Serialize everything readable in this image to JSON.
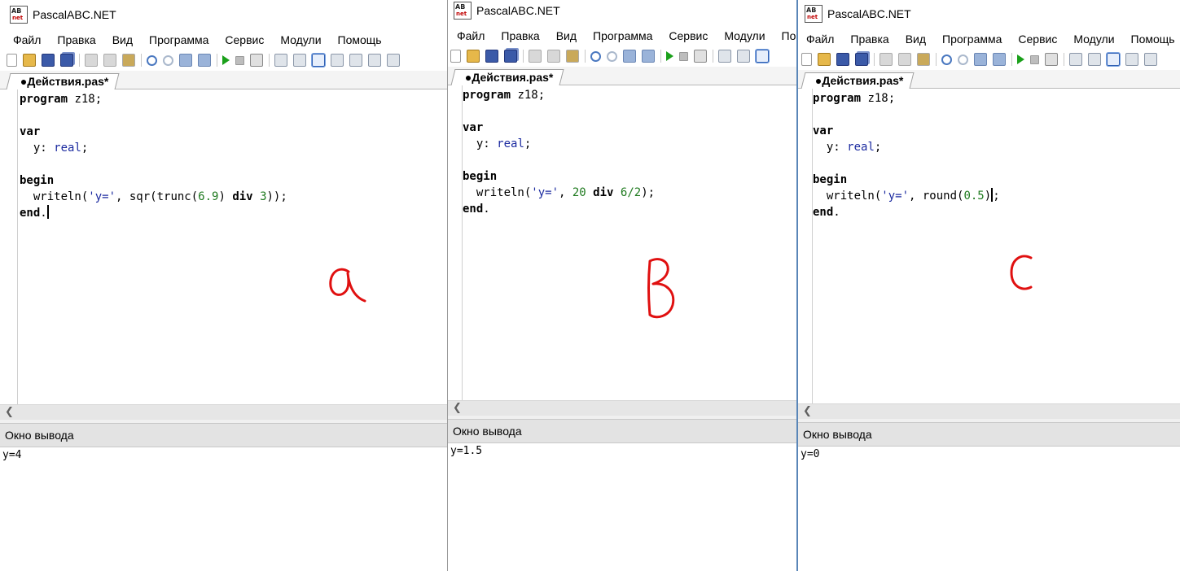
{
  "app_title": "PascalABC.NET",
  "app_icon": {
    "top": "AB",
    "bottom": "net"
  },
  "menu": [
    "Файл",
    "Правка",
    "Вид",
    "Программа",
    "Сервис",
    "Модули",
    "Помощь"
  ],
  "menu_truncated_b": "Пом",
  "tab_label": "●Действия.pas*",
  "output_title": "Окно вывода",
  "panels": {
    "a": {
      "annotation": "a",
      "output": "y=4"
    },
    "b": {
      "annotation": "B",
      "output": "y=1.5"
    },
    "c": {
      "annotation": "C",
      "output": "y=0"
    }
  },
  "code": {
    "program_kw": "program",
    "program_name": " z18;",
    "var_kw": "var",
    "decl_name": "  y: ",
    "decl_type": "real",
    "decl_end": ";",
    "begin_kw": "begin",
    "end_kw": "end",
    "end_dot": ".",
    "a_line": {
      "p1": "  writeln(",
      "s": "'y='",
      "p2": ", sqr(trunc(",
      "n1": "6.9",
      "p3": ") ",
      "kw": "div",
      "p4": " ",
      "n2": "3",
      "p5": "));"
    },
    "b_line": {
      "p1": "  writeln(",
      "s": "'y='",
      "p2": ", ",
      "n1": "20",
      "p3": " ",
      "kw": "div",
      "p4": " ",
      "n2": "6/2",
      "p5": ");"
    },
    "c_line": {
      "p1": "  writeln(",
      "s": "'y='",
      "p2": ", round(",
      "n1": "0.5",
      "p3": ")",
      "p4": ";"
    }
  },
  "colors": {
    "keyword": "#000000",
    "type": "#1c2ba0",
    "string": "#1c2ba0",
    "number": "#1f7a1f",
    "annotation": "#e01010",
    "window_border_c": "#5a86b8"
  },
  "icons": [
    "new-file-icon",
    "open-icon",
    "save-icon",
    "save-all-icon",
    "cut-icon",
    "copy-icon",
    "paste-icon",
    "undo-icon",
    "redo-icon",
    "back-icon",
    "forward-icon",
    "run-icon",
    "stop-icon",
    "debug-icon",
    "toggle-output-icon",
    "misc-icon"
  ]
}
